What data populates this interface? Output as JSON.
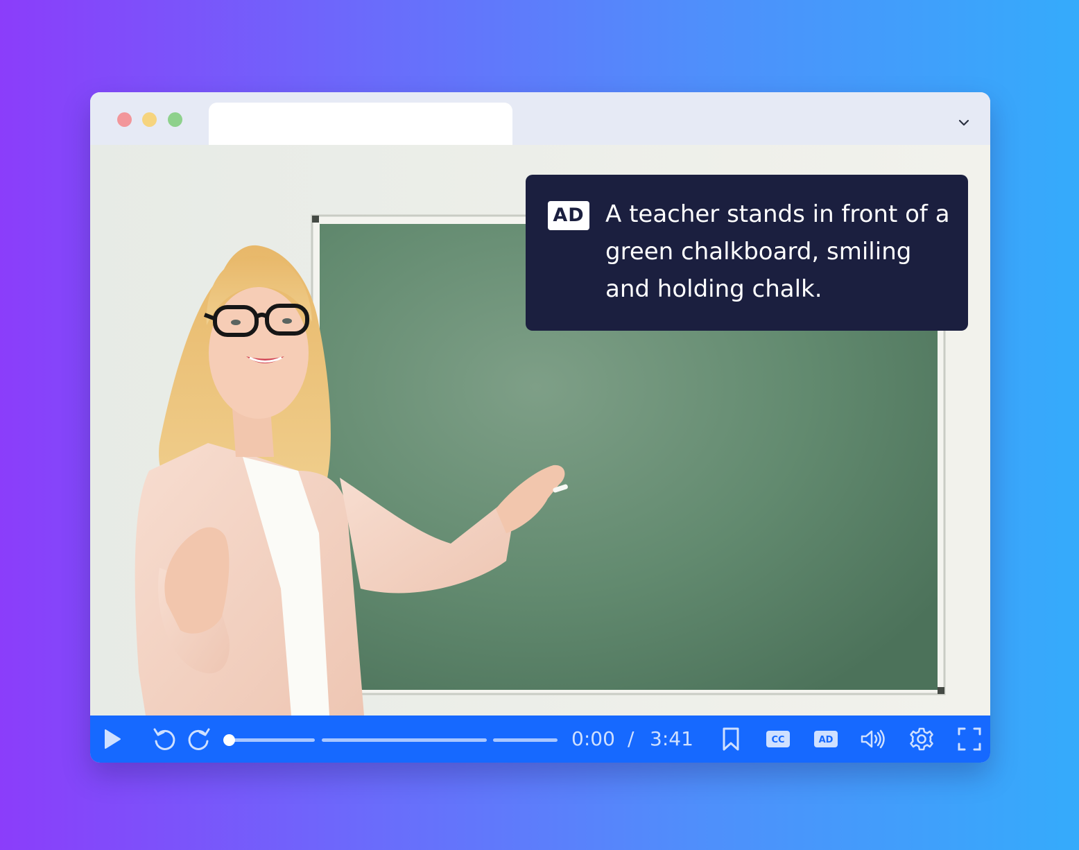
{
  "window": {
    "traffic_lights": [
      "close",
      "minimize",
      "maximize"
    ],
    "tab_title": "",
    "menu_icon": "chevron-down-icon"
  },
  "video": {
    "scene": "teacher at green chalkboard",
    "audio_description": {
      "badge": "AD",
      "text": "A teacher stands in front of a green chalkboard, smiling and holding chalk."
    }
  },
  "player": {
    "current_time": "0:00",
    "separator": "/",
    "duration": "3:41",
    "progress": 0,
    "cc_label": "CC",
    "ad_label": "AD",
    "accent_color": "#1669ff",
    "icons": [
      "play-icon",
      "rewind-icon",
      "forward-icon",
      "bookmark-icon",
      "cc-icon",
      "ad-icon",
      "volume-icon",
      "settings-icon",
      "fullscreen-icon"
    ]
  }
}
